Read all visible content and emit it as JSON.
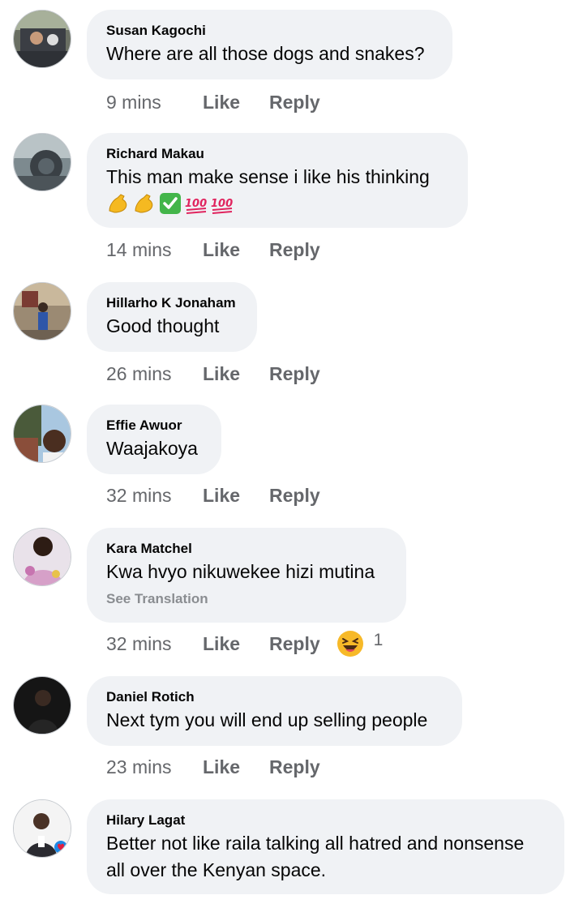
{
  "comments": [
    {
      "author": "Susan Kagochi",
      "text": "Where are all those dogs and snakes?",
      "time": "9 mins",
      "like": "Like",
      "reply": "Reply"
    },
    {
      "author": "Richard Makau",
      "text": "This man make sense i like his thinking",
      "emojis": [
        "flexed-biceps",
        "flexed-biceps",
        "check-mark-button",
        "hundred-points",
        "hundred-points"
      ],
      "time": "14 mins",
      "like": "Like",
      "reply": "Reply"
    },
    {
      "author": "Hillarho K Jonaham",
      "text": "Good thought",
      "time": "26 mins",
      "like": "Like",
      "reply": "Reply"
    },
    {
      "author": "Effie Awuor",
      "text": "Waajakoya",
      "time": "32 mins",
      "like": "Like",
      "reply": "Reply"
    },
    {
      "author": "Kara Matchel",
      "text": "Kwa hvyo nikuwekee hizi mutina",
      "see_translation": "See Translation",
      "time": "32 mins",
      "like": "Like",
      "reply": "Reply",
      "reaction": {
        "icon": "laughing-face-icon",
        "count": "1"
      }
    },
    {
      "author": "Daniel Rotich",
      "text": "Next tym you will end up selling people",
      "time": "23 mins",
      "like": "Like",
      "reply": "Reply"
    },
    {
      "author": "Hilary Lagat",
      "text_lines": [
        "Better not like raila talking all hatred and nonsense",
        "all over the Kenyan space."
      ]
    }
  ],
  "colors": {
    "bubble": "#f0f2f5",
    "meta": "#65676b",
    "translate": "#8a8d91",
    "text": "#050505"
  }
}
